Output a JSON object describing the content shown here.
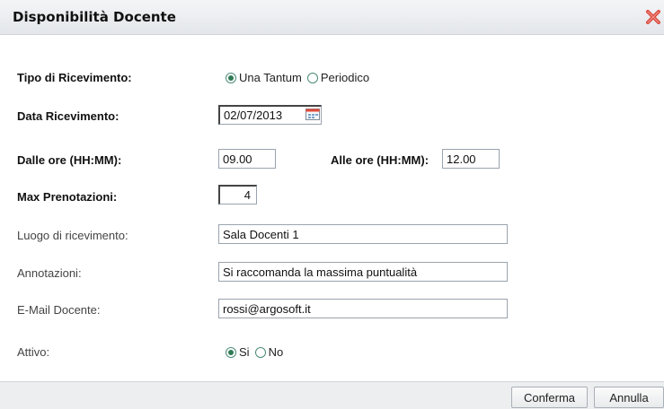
{
  "dialog": {
    "title": "Disponibilità Docente",
    "close_icon": "close-icon"
  },
  "form": {
    "tipo_label": "Tipo di Ricevimento:",
    "tipo_options": [
      "Una Tantum",
      "Periodico"
    ],
    "tipo_selected": "Una Tantum",
    "data_label": "Data Ricevimento:",
    "data_value": "02/07/2013",
    "calendar_icon": "calendar-icon",
    "dalle_label": "Dalle ore (HH:MM):",
    "dalle_value": "09.00",
    "alle_label": "Alle ore (HH:MM):",
    "alle_value": "12.00",
    "max_label": "Max Prenotazioni:",
    "max_value": "4",
    "luogo_label": "Luogo di ricevimento:",
    "luogo_value": "Sala Docenti 1",
    "annotazioni_label": "Annotazioni:",
    "annotazioni_value": "Si raccomanda la massima puntualità",
    "email_label": "E-Mail Docente:",
    "email_value": "rossi@argosoft.it",
    "attivo_label": "Attivo:",
    "attivo_options": [
      "Si",
      "No"
    ],
    "attivo_selected": "Si"
  },
  "footer": {
    "confirm_label": "Conferma",
    "cancel_label": "Annulla"
  },
  "colors": {
    "radio_accent": "#2f7a55",
    "close_red": "#d9463a"
  }
}
